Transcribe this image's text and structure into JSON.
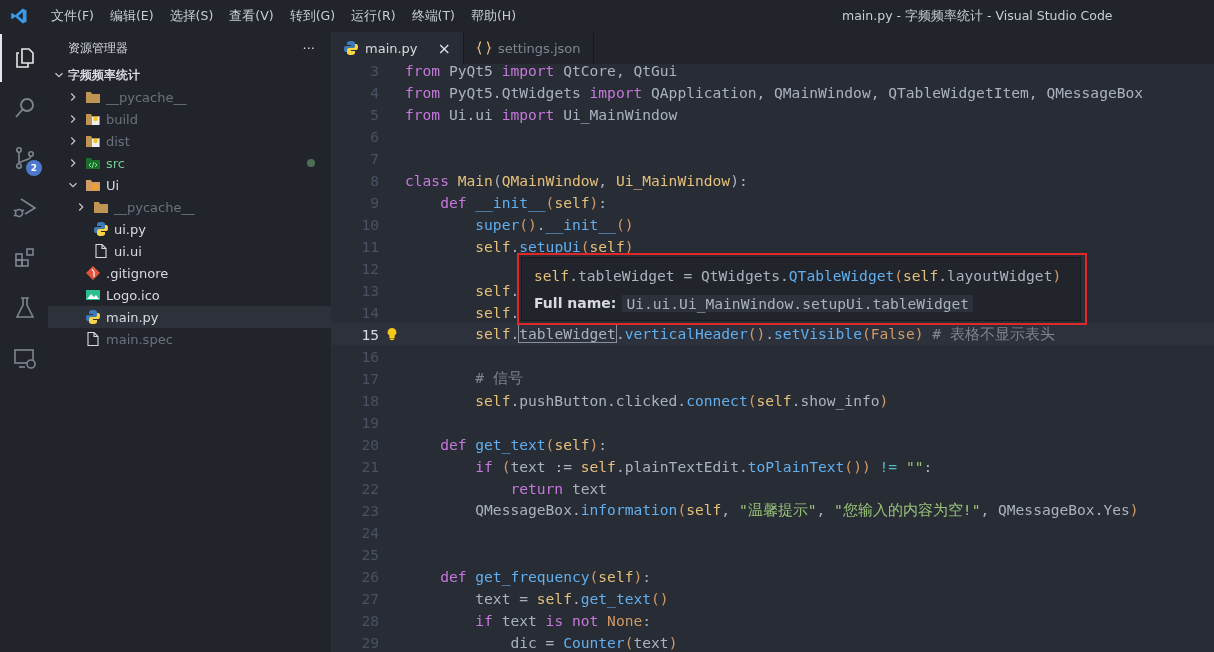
{
  "window": {
    "title": "main.py - 字频频率统计 - Visual Studio Code"
  },
  "menu": [
    "文件(F)",
    "编辑(E)",
    "选择(S)",
    "查看(V)",
    "转到(G)",
    "运行(R)",
    "终端(T)",
    "帮助(H)"
  ],
  "activity_bar": [
    {
      "kind": "explorer",
      "selected": true
    },
    {
      "kind": "search",
      "selected": false
    },
    {
      "kind": "scm",
      "selected": false,
      "badge": "2"
    },
    {
      "kind": "debug",
      "selected": false
    },
    {
      "kind": "extensions",
      "selected": false
    },
    {
      "kind": "testing",
      "selected": false
    },
    {
      "kind": "remote",
      "selected": false
    }
  ],
  "sidebar": {
    "title": "资源管理器",
    "more": "···",
    "root": {
      "label": "字频频率统计",
      "expanded": true
    },
    "items": [
      {
        "label": "__pycache__",
        "kind": "folder",
        "expanded": false,
        "ignored": true,
        "untracked": false,
        "selected": false
      },
      {
        "label": "build",
        "kind": "folder-build",
        "expanded": false,
        "ignored": true,
        "untracked": false,
        "selected": false
      },
      {
        "label": "dist",
        "kind": "folder-build",
        "expanded": false,
        "ignored": true,
        "untracked": false,
        "selected": false
      },
      {
        "label": "src",
        "kind": "folder-src",
        "expanded": false,
        "ignored": false,
        "untracked": true,
        "selected": false
      },
      {
        "label": "Ui",
        "kind": "folder-ui",
        "expanded": true,
        "ignored": false,
        "untracked": false,
        "selected": false,
        "children": [
          {
            "label": "__pycache__",
            "kind": "folder",
            "expanded": false,
            "ignored": true,
            "untracked": false,
            "selected": false
          },
          {
            "label": "ui.py",
            "kind": "python",
            "ignored": false,
            "untracked": false,
            "selected": false
          },
          {
            "label": "ui.ui",
            "kind": "file",
            "ignored": false,
            "untracked": false,
            "selected": false
          }
        ]
      },
      {
        "label": ".gitignore",
        "kind": "git",
        "ignored": false,
        "untracked": false,
        "selected": false
      },
      {
        "label": "Logo.ico",
        "kind": "image",
        "ignored": false,
        "untracked": false,
        "selected": false
      },
      {
        "label": "main.py",
        "kind": "python",
        "ignored": false,
        "untracked": false,
        "selected": true
      },
      {
        "label": "main.spec",
        "kind": "file",
        "ignored": true,
        "untracked": false,
        "selected": false
      }
    ]
  },
  "tabs": [
    {
      "label": "main.py",
      "kind": "python",
      "selected": true,
      "close": "×"
    },
    {
      "label": "settings.json",
      "kind": "json",
      "selected": false
    }
  ],
  "code": [
    {
      "n": "3",
      "current": false,
      "tokens": [
        {
          "kind": "kw",
          "t": "from"
        },
        {
          "kind": "p",
          "t": " PyQt5 "
        },
        {
          "kind": "kw",
          "t": "import"
        },
        {
          "kind": "p",
          "t": " QtCore, QtGui"
        }
      ]
    },
    {
      "n": "4",
      "current": false,
      "tokens": [
        {
          "kind": "kw",
          "t": "from"
        },
        {
          "kind": "p",
          "t": " PyQt5.QtWidgets "
        },
        {
          "kind": "kw",
          "t": "import"
        },
        {
          "kind": "p",
          "t": " QApplication, QMainWindow, QTableWidgetItem, QMessageBox"
        }
      ]
    },
    {
      "n": "5",
      "current": false,
      "tokens": [
        {
          "kind": "kw",
          "t": "from"
        },
        {
          "kind": "p",
          "t": " Ui.ui "
        },
        {
          "kind": "kw",
          "t": "import"
        },
        {
          "kind": "p",
          "t": " Ui_MainWindow"
        }
      ]
    },
    {
      "n": "6",
      "current": false
    },
    {
      "n": "7",
      "current": false
    },
    {
      "n": "8",
      "current": false,
      "tokens": [
        {
          "kind": "kw",
          "t": "class"
        },
        {
          "kind": "cls",
          "t": " Main"
        },
        {
          "kind": "p",
          "t": "("
        },
        {
          "kind": "cls",
          "t": "QMainWindow"
        },
        {
          "kind": "p",
          "t": ", "
        },
        {
          "kind": "cls",
          "t": "Ui_MainWindow"
        },
        {
          "kind": "p",
          "t": "):"
        }
      ]
    },
    {
      "n": "9",
      "current": false,
      "tokens": [
        {
          "kind": "kw",
          "t": "    def"
        },
        {
          "kind": "fn",
          "t": " __init__"
        },
        {
          "kind": "br",
          "t": "("
        },
        {
          "kind": "self",
          "t": "self"
        },
        {
          "kind": "br",
          "t": ")"
        },
        {
          "kind": "p",
          "t": ":"
        }
      ]
    },
    {
      "n": "10",
      "current": false,
      "tokens": [
        {
          "kind": "fn",
          "t": "        super"
        },
        {
          "kind": "br",
          "t": "()"
        },
        {
          "kind": "p",
          "t": "."
        },
        {
          "kind": "fn",
          "t": "__init__"
        },
        {
          "kind": "br",
          "t": "()"
        }
      ]
    },
    {
      "n": "11",
      "current": false,
      "tokens": [
        {
          "kind": "self",
          "t": "        self"
        },
        {
          "kind": "p",
          "t": "."
        },
        {
          "kind": "fn",
          "t": "setupUi"
        },
        {
          "kind": "br",
          "t": "("
        },
        {
          "kind": "self",
          "t": "self"
        },
        {
          "kind": "br",
          "t": ")"
        }
      ]
    },
    {
      "n": "12",
      "current": false
    },
    {
      "n": "13",
      "current": false,
      "tokens": [
        {
          "kind": "self",
          "t": "        self"
        },
        {
          "kind": "p",
          "t": "."
        }
      ]
    },
    {
      "n": "14",
      "current": false,
      "tokens": [
        {
          "kind": "self",
          "t": "        self"
        },
        {
          "kind": "p",
          "t": "."
        }
      ]
    },
    {
      "n": "15",
      "current": true,
      "tokens": [
        {
          "kind": "self",
          "t": "        self"
        },
        {
          "kind": "p",
          "t": "."
        },
        {
          "kind": "hl",
          "t": "tableWidget"
        },
        {
          "kind": "p",
          "t": "."
        },
        {
          "kind": "fn",
          "t": "verticalHeader"
        },
        {
          "kind": "br",
          "t": "()"
        },
        {
          "kind": "p",
          "t": "."
        },
        {
          "kind": "fn",
          "t": "setVisible"
        },
        {
          "kind": "br",
          "t": "("
        },
        {
          "kind": "const",
          "t": "False"
        },
        {
          "kind": "br",
          "t": ")"
        },
        {
          "kind": "cm",
          "t": " # 表格不显示表头"
        }
      ]
    },
    {
      "n": "16",
      "current": false
    },
    {
      "n": "17",
      "current": false,
      "tokens": [
        {
          "kind": "cm",
          "t": "        # 信号"
        }
      ]
    },
    {
      "n": "18",
      "current": false,
      "tokens": [
        {
          "kind": "self",
          "t": "        self"
        },
        {
          "kind": "p",
          "t": ".pushButton.clicked."
        },
        {
          "kind": "fn",
          "t": "connect"
        },
        {
          "kind": "br",
          "t": "("
        },
        {
          "kind": "self",
          "t": "self"
        },
        {
          "kind": "p",
          "t": ".show_info"
        },
        {
          "kind": "br",
          "t": ")"
        }
      ]
    },
    {
      "n": "19",
      "current": false
    },
    {
      "n": "20",
      "current": false,
      "tokens": [
        {
          "kind": "kw",
          "t": "    def"
        },
        {
          "kind": "fn",
          "t": " get_text"
        },
        {
          "kind": "br",
          "t": "("
        },
        {
          "kind": "self",
          "t": "self"
        },
        {
          "kind": "br",
          "t": ")"
        },
        {
          "kind": "p",
          "t": ":"
        }
      ]
    },
    {
      "n": "21",
      "current": false,
      "tokens": [
        {
          "kind": "kw",
          "t": "        if"
        },
        {
          "kind": "br",
          "t": " ("
        },
        {
          "kind": "p",
          "t": "text := "
        },
        {
          "kind": "self",
          "t": "self"
        },
        {
          "kind": "p",
          "t": ".plainTextEdit."
        },
        {
          "kind": "fn",
          "t": "toPlainText"
        },
        {
          "kind": "br",
          "t": "())"
        },
        {
          "kind": "op",
          "t": " != "
        },
        {
          "kind": "str",
          "t": "\"\""
        },
        {
          "kind": "p",
          "t": ":"
        }
      ]
    },
    {
      "n": "22",
      "current": false,
      "tokens": [
        {
          "kind": "kw",
          "t": "            return"
        },
        {
          "kind": "p",
          "t": " text"
        }
      ]
    },
    {
      "n": "23",
      "current": false,
      "tokens": [
        {
          "kind": "p",
          "t": "        QMessageBox."
        },
        {
          "kind": "fn",
          "t": "information"
        },
        {
          "kind": "br",
          "t": "("
        },
        {
          "kind": "self",
          "t": "self"
        },
        {
          "kind": "p",
          "t": ", "
        },
        {
          "kind": "str",
          "t": "\"温馨提示\""
        },
        {
          "kind": "p",
          "t": ", "
        },
        {
          "kind": "str",
          "t": "\"您输入的内容为空!\""
        },
        {
          "kind": "p",
          "t": ", QMessageBox.Yes"
        },
        {
          "kind": "br",
          "t": ")"
        }
      ]
    },
    {
      "n": "24",
      "current": false
    },
    {
      "n": "25",
      "current": false
    },
    {
      "n": "26",
      "current": false,
      "tokens": [
        {
          "kind": "kw",
          "t": "    def"
        },
        {
          "kind": "fn",
          "t": " get_frequency"
        },
        {
          "kind": "br",
          "t": "("
        },
        {
          "kind": "self",
          "t": "self"
        },
        {
          "kind": "br",
          "t": ")"
        },
        {
          "kind": "p",
          "t": ":"
        }
      ]
    },
    {
      "n": "27",
      "current": false,
      "tokens": [
        {
          "kind": "p",
          "t": "        text = "
        },
        {
          "kind": "self",
          "t": "self"
        },
        {
          "kind": "p",
          "t": "."
        },
        {
          "kind": "fn",
          "t": "get_text"
        },
        {
          "kind": "br",
          "t": "()"
        }
      ]
    },
    {
      "n": "28",
      "current": false,
      "tokens": [
        {
          "kind": "kw",
          "t": "        if"
        },
        {
          "kind": "p",
          "t": " text "
        },
        {
          "kind": "kw",
          "t": "is not"
        },
        {
          "kind": "const",
          "t": " None"
        },
        {
          "kind": "p",
          "t": ":"
        }
      ]
    },
    {
      "n": "29",
      "current": false,
      "tokens": [
        {
          "kind": "p",
          "t": "            dic = "
        },
        {
          "kind": "fn",
          "t": "Counter"
        },
        {
          "kind": "br",
          "t": "("
        },
        {
          "kind": "p",
          "t": "text"
        },
        {
          "kind": "br",
          "t": ")"
        }
      ]
    }
  ],
  "hover": {
    "definition": [
      {
        "kind": "self",
        "t": "self"
      },
      {
        "kind": "p",
        "t": ".tableWidget = QtWidgets."
      },
      {
        "kind": "fn",
        "t": "QTableWidget"
      },
      {
        "kind": "br",
        "t": "("
      },
      {
        "kind": "self",
        "t": "self"
      },
      {
        "kind": "p",
        "t": ".layoutWidget"
      },
      {
        "kind": "br",
        "t": ")"
      }
    ],
    "label": "Full name:",
    "value": "Ui.ui.Ui_MainWindow.setupUi.tableWidget"
  }
}
